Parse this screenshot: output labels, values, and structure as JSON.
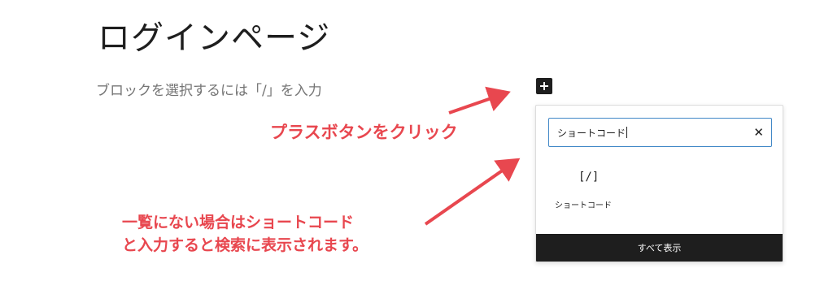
{
  "page": {
    "title": "ログインページ",
    "block_placeholder": "ブロックを選択するには「/」を入力"
  },
  "inserter": {
    "search_value": "ショートコード",
    "clear_icon": "close-icon",
    "results": [
      {
        "icon_glyph": "[/]",
        "icon": "shortcode-icon",
        "label": "ショートコード"
      }
    ],
    "show_all_label": "すべて表示"
  },
  "annotations": {
    "plus_button_note": "プラスボタンをクリック",
    "search_note_line1": "一覧にない場合はショートコード",
    "search_note_line2": "と入力すると検索に表示されます。",
    "color": "#e8474f"
  }
}
